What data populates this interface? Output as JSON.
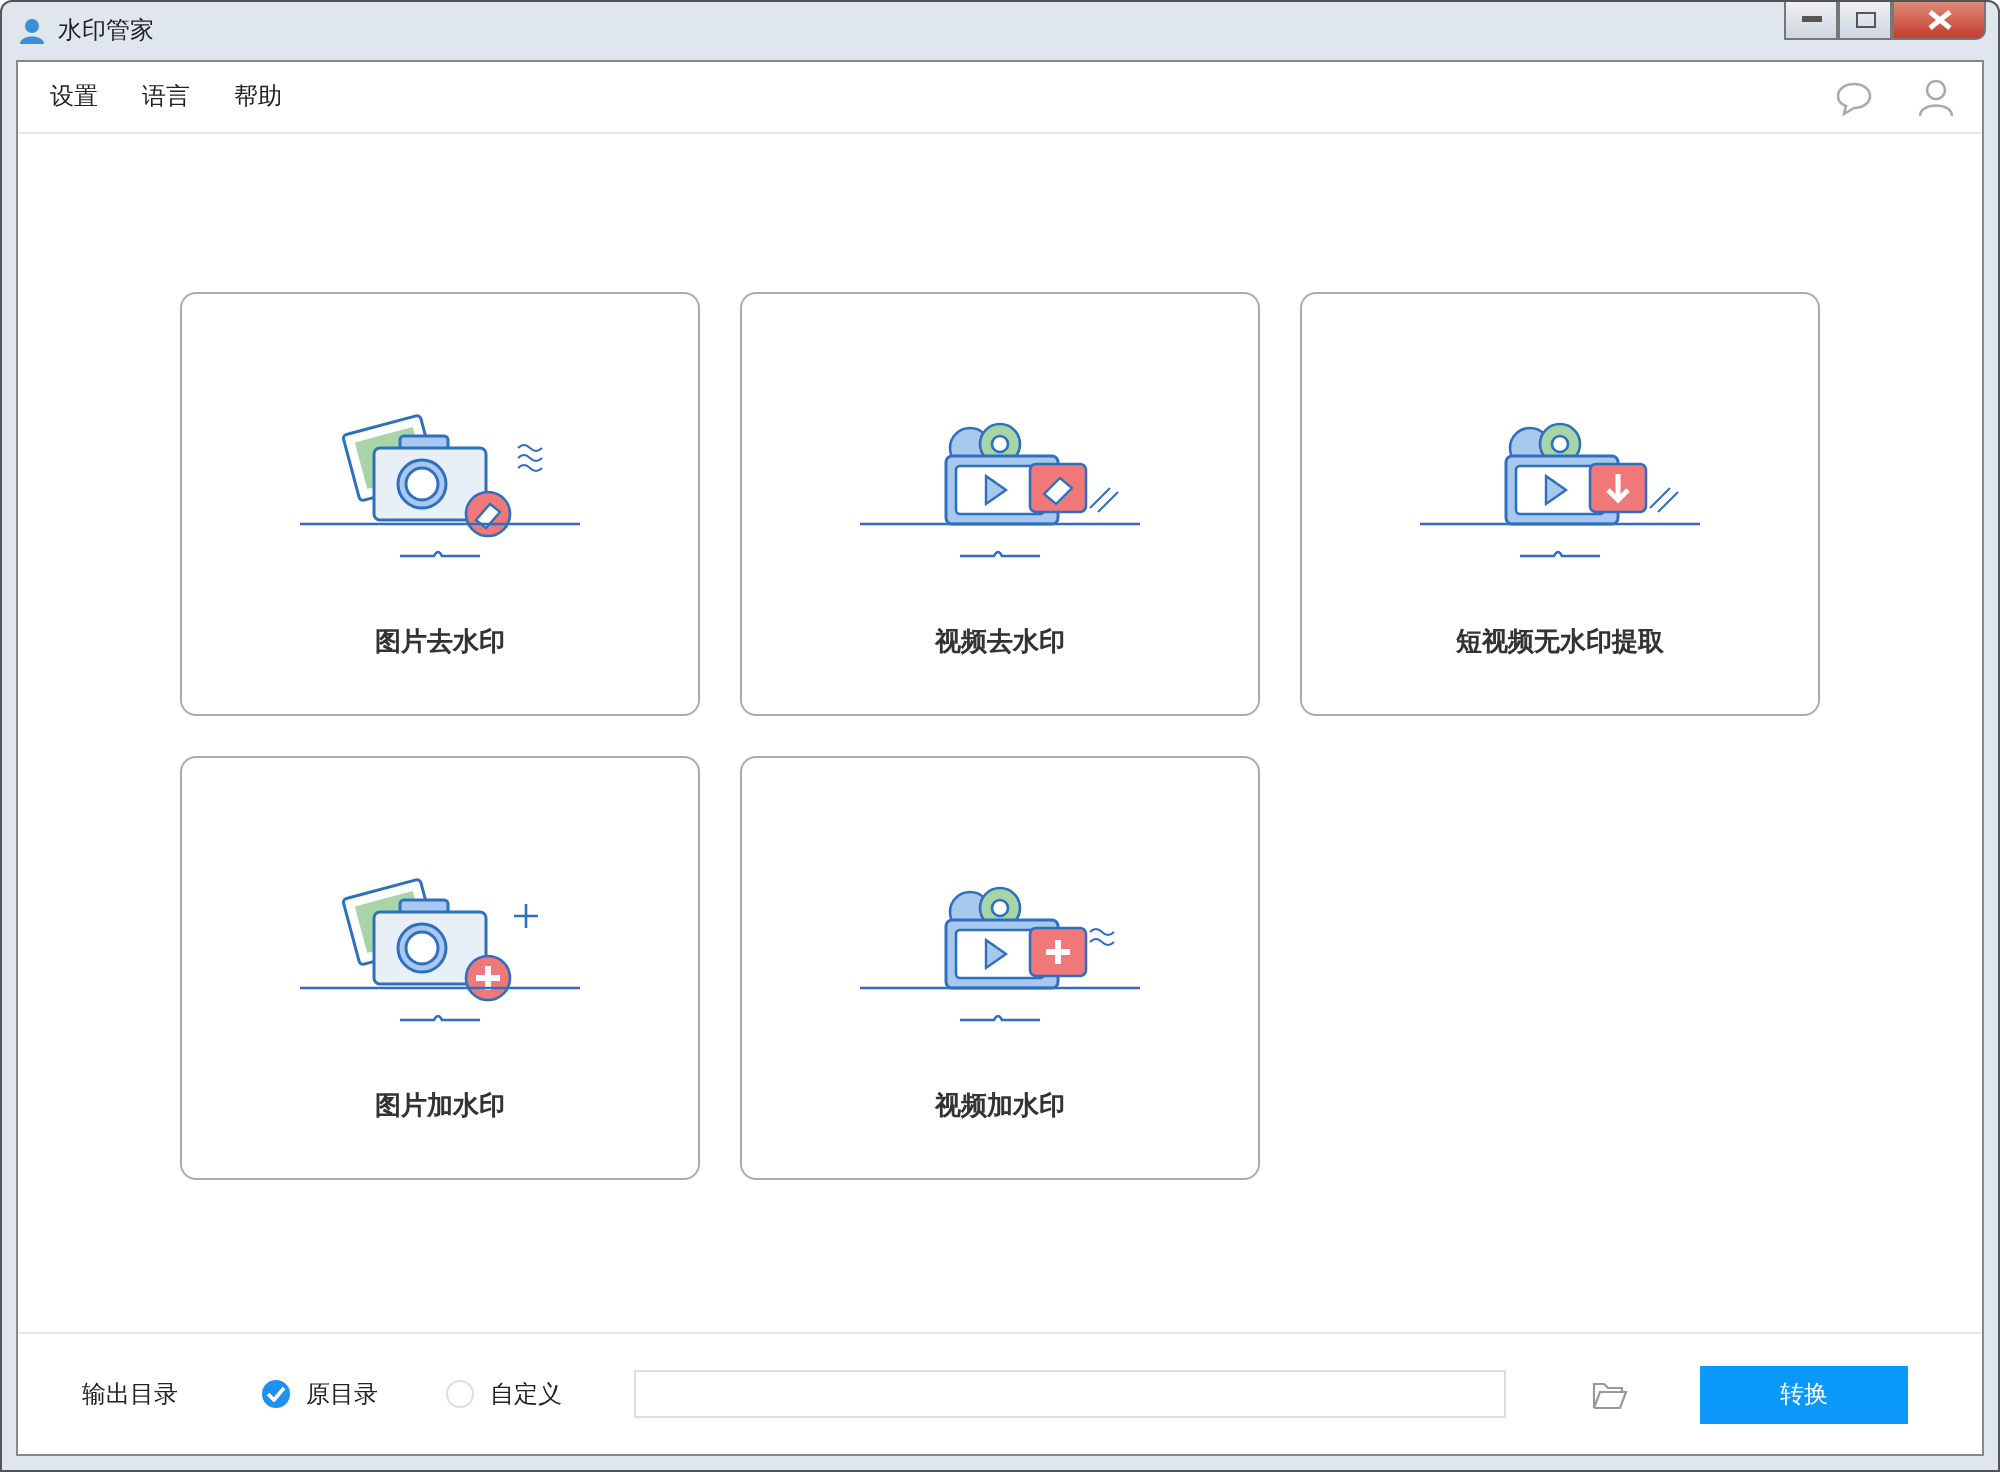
{
  "window": {
    "title": "水印管家"
  },
  "menu": [
    "设置",
    "语言",
    "帮助"
  ],
  "cards": [
    {
      "kind": "photo-remove",
      "label": "图片去水印"
    },
    {
      "kind": "video-remove",
      "label": "视频去水印"
    },
    {
      "kind": "video-extract",
      "label": "短视频无水印提取"
    },
    {
      "kind": "photo-add",
      "label": "图片加水印"
    },
    {
      "kind": "video-add",
      "label": "视频加水印"
    }
  ],
  "footer": {
    "label": "输出目录",
    "options": [
      {
        "label": "原目录",
        "selected": true
      },
      {
        "label": "自定义",
        "selected": false
      }
    ],
    "button": "转换"
  }
}
